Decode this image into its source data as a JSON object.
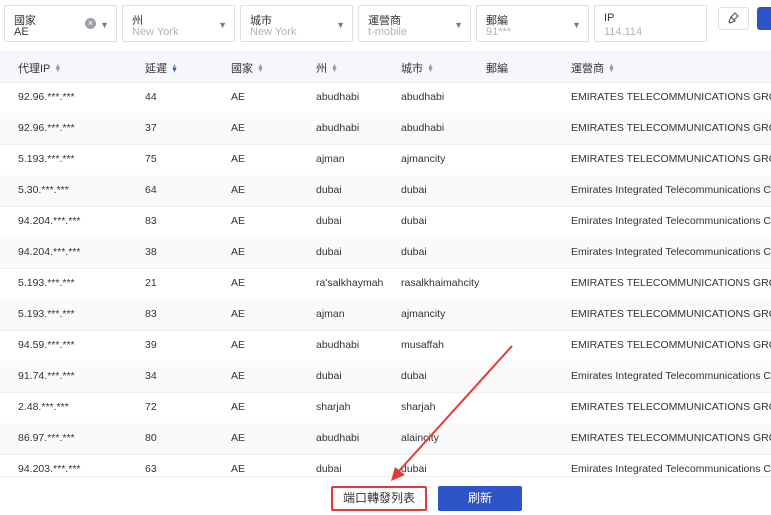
{
  "filters": {
    "country": {
      "label": "國家",
      "value": "AE"
    },
    "state": {
      "label": "州",
      "placeholder": "New York"
    },
    "city": {
      "label": "城市",
      "placeholder": "New York"
    },
    "isp": {
      "label": "運營商",
      "placeholder": "t-mobile"
    },
    "zip": {
      "label": "郵編",
      "placeholder": "91***"
    },
    "ip": {
      "label": "IP",
      "placeholder": "114.114"
    }
  },
  "table": {
    "headers": [
      "代理IP",
      "延遲",
      "國家",
      "州",
      "城市",
      "郵編",
      "運營商"
    ],
    "rows": [
      [
        "92.96.***.***",
        "44",
        "AE",
        "abudhabi",
        "abudhabi",
        "",
        "EMIRATES TELECOMMUNICATIONS GROUP"
      ],
      [
        "92.96.***.***",
        "37",
        "AE",
        "abudhabi",
        "abudhabi",
        "",
        "EMIRATES TELECOMMUNICATIONS GROUP"
      ],
      [
        "5.193.***.***",
        "75",
        "AE",
        "ajman",
        "ajmancity",
        "",
        "EMIRATES TELECOMMUNICATIONS GROUP"
      ],
      [
        "5.30.***.***",
        "64",
        "AE",
        "dubai",
        "dubai",
        "",
        "Emirates Integrated Telecommunications Co"
      ],
      [
        "94.204.***.***",
        "83",
        "AE",
        "dubai",
        "dubai",
        "",
        "Emirates Integrated Telecommunications Co"
      ],
      [
        "94.204.***.***",
        "38",
        "AE",
        "dubai",
        "dubai",
        "",
        "Emirates Integrated Telecommunications Co"
      ],
      [
        "5.193.***.***",
        "21",
        "AE",
        "ra'salkhaymah",
        "rasalkhaimahcity",
        "",
        "EMIRATES TELECOMMUNICATIONS GROUP"
      ],
      [
        "5.193.***.***",
        "83",
        "AE",
        "ajman",
        "ajmancity",
        "",
        "EMIRATES TELECOMMUNICATIONS GROUP"
      ],
      [
        "94.59.***.***",
        "39",
        "AE",
        "abudhabi",
        "musaffah",
        "",
        "EMIRATES TELECOMMUNICATIONS GROUP"
      ],
      [
        "91.74.***.***",
        "34",
        "AE",
        "dubai",
        "dubai",
        "",
        "Emirates Integrated Telecommunications Co"
      ],
      [
        "2.48.***.***",
        "72",
        "AE",
        "sharjah",
        "sharjah",
        "",
        "EMIRATES TELECOMMUNICATIONS GROUP"
      ],
      [
        "86.97.***.***",
        "80",
        "AE",
        "abudhabi",
        "alaincity",
        "",
        "EMIRATES TELECOMMUNICATIONS GROUP"
      ],
      [
        "94.203.***.***",
        "63",
        "AE",
        "dubai",
        "dubai",
        "",
        "Emirates Integrated Telecommunications Co"
      ]
    ]
  },
  "footer": {
    "port_list_label": "端口轉發列表",
    "refresh_label": "刷新"
  },
  "colors": {
    "primary": "#2f54c8",
    "highlight": "#e53935"
  },
  "icons": {
    "tool": "broom-icon"
  }
}
